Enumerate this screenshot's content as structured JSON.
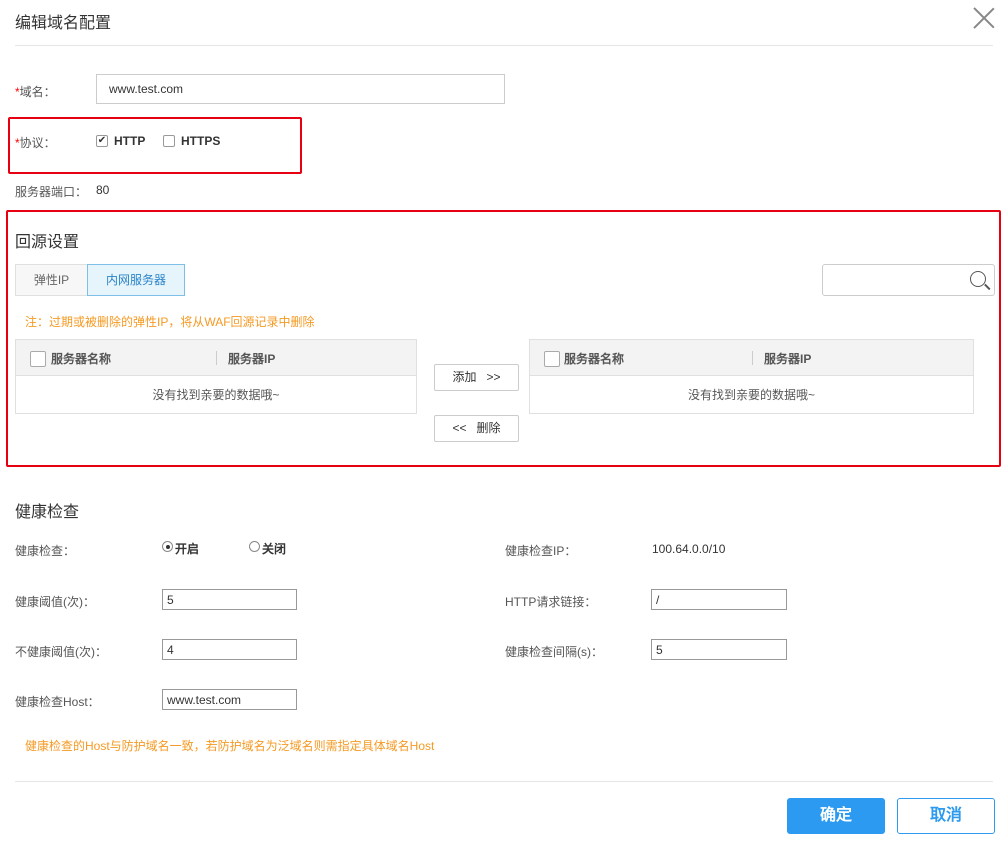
{
  "dialog": {
    "title": "编辑域名配置"
  },
  "domain": {
    "required_mark": "*",
    "label": "域名：",
    "value": "www.test.com"
  },
  "protocol": {
    "required_mark": "*",
    "label": "协议：",
    "options": [
      {
        "label": "HTTP",
        "checked": true
      },
      {
        "label": "HTTPS",
        "checked": false
      }
    ]
  },
  "server_port": {
    "label": "服务器端口：",
    "value": "80"
  },
  "origin": {
    "title": "回源设置",
    "tabs": [
      {
        "label": "弹性IP",
        "active": false
      },
      {
        "label": "内网服务器",
        "active": true
      }
    ],
    "search": {
      "value": ""
    },
    "note": "注：过期或被删除的弹性IP，将从WAF回源记录中删除",
    "left_table": {
      "col1": "服务器名称",
      "col2": "服务器IP",
      "empty": "没有找到亲要的数据哦~"
    },
    "right_table": {
      "col1": "服务器名称",
      "col2": "服务器IP",
      "empty": "没有找到亲要的数据哦~"
    },
    "add_button": "添加   >>",
    "remove_button": "<<   删除"
  },
  "health": {
    "title": "健康检查",
    "check_label": "健康检查：",
    "options": [
      {
        "label": "开启",
        "selected": true
      },
      {
        "label": "关闭",
        "selected": false
      }
    ],
    "check_ip_label": "健康检查IP：",
    "check_ip_value": "100.64.0.0/10",
    "threshold_label": "健康阈值(次)：",
    "threshold_value": "5",
    "http_link_label": "HTTP请求链接：",
    "http_link_value": "/",
    "unhealthy_label": "不健康阈值(次)：",
    "unhealthy_value": "4",
    "interval_label": "健康检查间隔(s)：",
    "interval_value": "5",
    "host_label": "健康检查Host：",
    "host_value": "www.test.com",
    "note": "健康检查的Host与防护域名一致，若防护域名为泛域名则需指定具体域名Host"
  },
  "footer": {
    "confirm": "确定",
    "cancel": "取消"
  },
  "colors": {
    "accent": "#2c9af0",
    "warning": "#f59a23",
    "highlight_border": "#e60012"
  }
}
